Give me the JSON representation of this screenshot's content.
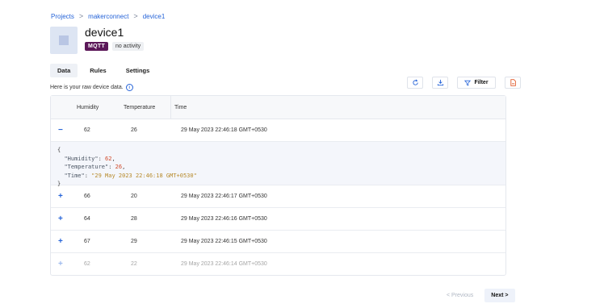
{
  "breadcrumb": {
    "items": [
      "Projects",
      "makerconnect",
      "device1"
    ],
    "separator": ">"
  },
  "device": {
    "title": "device1",
    "protocol_badge": "MQTT",
    "activity_badge": "no activity"
  },
  "tabs": [
    {
      "label": "Data",
      "active": true
    },
    {
      "label": "Rules",
      "active": false
    },
    {
      "label": "Settings",
      "active": false
    }
  ],
  "hint": {
    "text": "Here is your raw device data.",
    "icon": "info-icon"
  },
  "toolbar": {
    "refresh_icon": "refresh-icon",
    "download_icon": "download-icon",
    "filter_label": "Filter",
    "filter_icon": "funnel-icon",
    "pdf_icon": "pdf-icon"
  },
  "table": {
    "columns": [
      "Humidity",
      "Temperature",
      "Time"
    ],
    "rows": [
      {
        "toggle": "−",
        "humidity": "62",
        "temperature": "26",
        "time": "29 May 2023 22:46:18 GMT+0530",
        "expanded": true
      },
      {
        "toggle": "+",
        "humidity": "66",
        "temperature": "20",
        "time": "29 May 2023 22:46:17 GMT+0530",
        "expanded": false
      },
      {
        "toggle": "+",
        "humidity": "64",
        "temperature": "28",
        "time": "29 May 2023 22:46:16 GMT+0530",
        "expanded": false
      },
      {
        "toggle": "+",
        "humidity": "67",
        "temperature": "29",
        "time": "29 May 2023 22:46:15 GMT+0530",
        "expanded": false
      },
      {
        "toggle": "+",
        "humidity": "62",
        "temperature": "22",
        "time": "29 May 2023 22:46:14 GMT+0530",
        "expanded": false
      }
    ],
    "expanded_json": {
      "open": "{",
      "humidity_key": "\"Humidity\"",
      "humidity_val": "62",
      "temperature_key": "\"Temperature\"",
      "temperature_val": "26",
      "time_key": "\"Time\"",
      "time_val": "\"29 May 2023 22:46:18 GMT+0530\"",
      "close": "}"
    }
  },
  "pagination": {
    "prev_label": "< Previous",
    "next_label": "Next >"
  },
  "colors": {
    "accent": "#2563d8",
    "mqtt_badge": "#5b1758"
  }
}
